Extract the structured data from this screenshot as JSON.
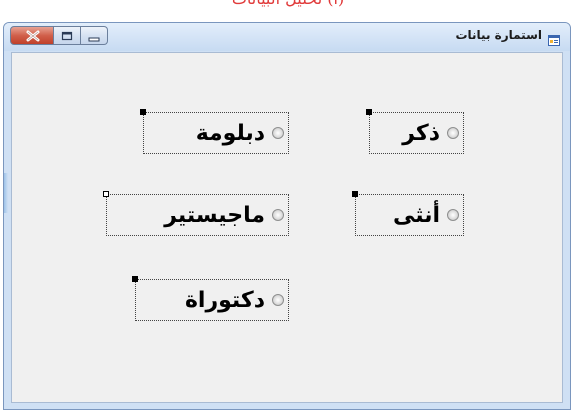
{
  "caption": "(أ) تحليل البيانات",
  "window": {
    "title": "استمارة بيانات"
  },
  "title_icon": "form-icon",
  "caption_buttons": {
    "close_icon": "close-icon",
    "maximize_icon": "maximize-icon",
    "minimize_icon": "minimize-icon"
  },
  "radios": [
    {
      "id": "male",
      "label": "ذكر",
      "checked": false,
      "selected_handle": "filled"
    },
    {
      "id": "diploma",
      "label": "دبلومة",
      "checked": false,
      "selected_handle": "filled"
    },
    {
      "id": "female",
      "label": "أنثى",
      "checked": false,
      "selected_handle": "filled"
    },
    {
      "id": "master",
      "label": "ماجيستير",
      "checked": false,
      "selected_handle": "hollow"
    },
    {
      "id": "doctorate",
      "label": "دكتوراة",
      "checked": false,
      "selected_handle": "filled"
    }
  ],
  "colors": {
    "caption_text": "#e03a3a",
    "window_frame": "#cfe0f4",
    "client_background": "#f0f0f0",
    "close_button": "#c9503a"
  }
}
